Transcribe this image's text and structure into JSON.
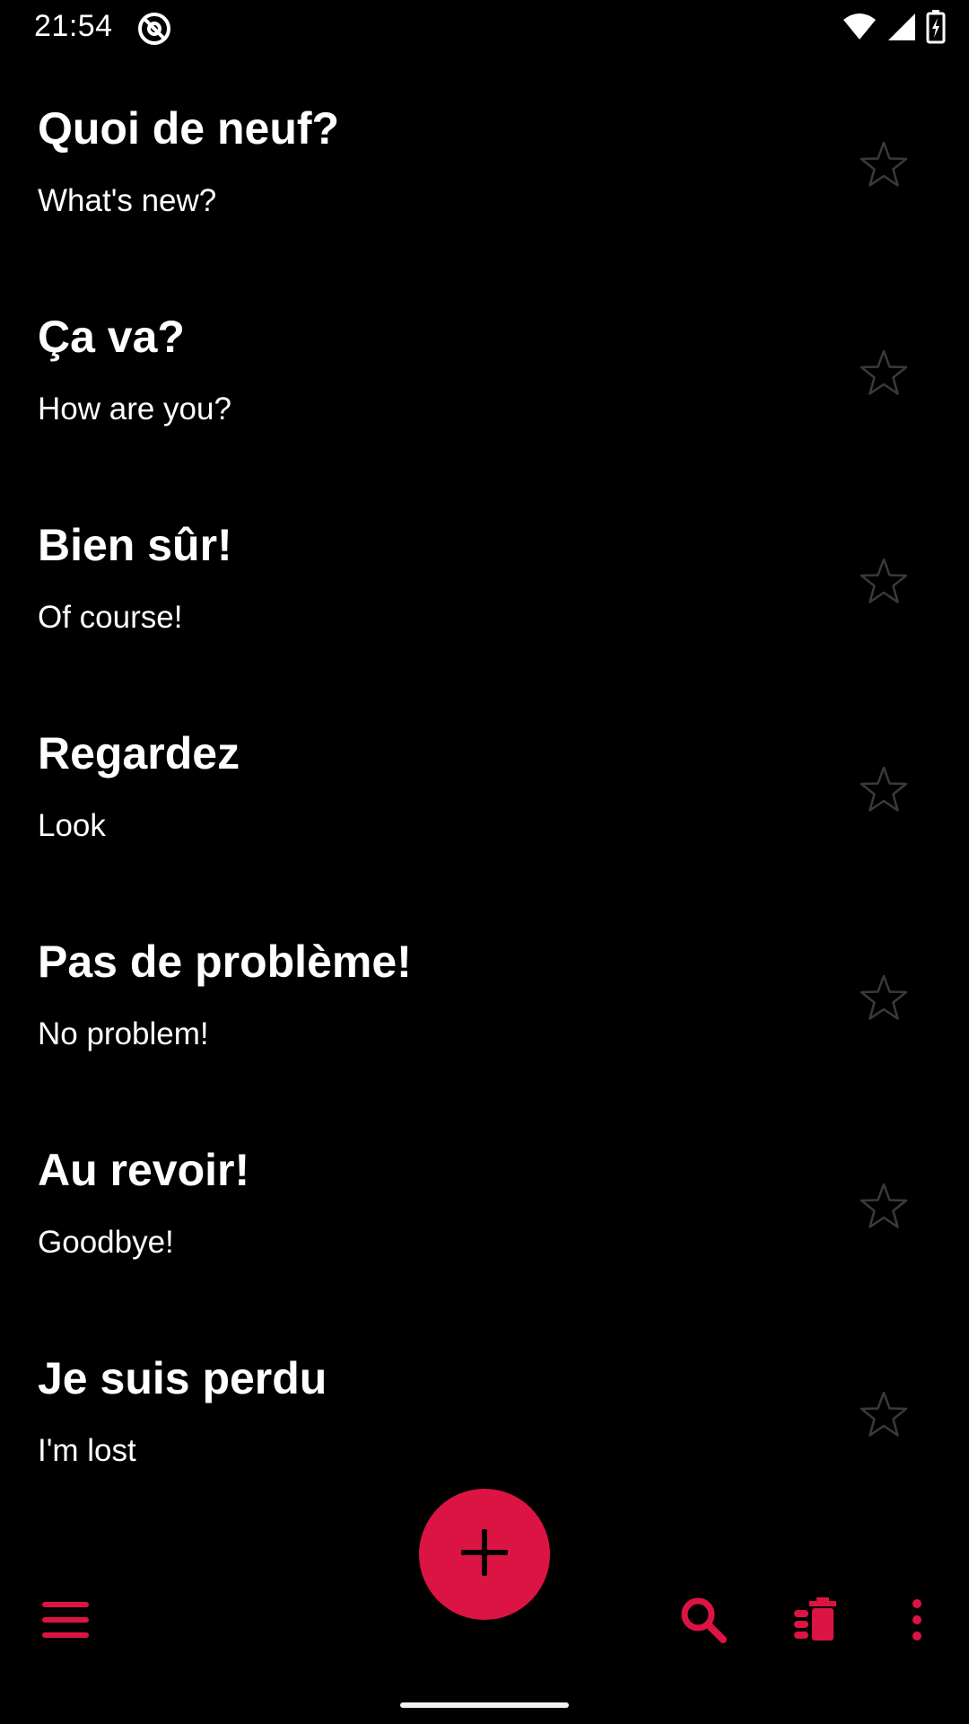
{
  "status_bar": {
    "time": "21:54",
    "icons": [
      "at-sign-icon",
      "wifi-icon",
      "signal-icon",
      "battery-charging-icon"
    ]
  },
  "phrases": [
    {
      "french": "Quoi de neuf?",
      "english": "What's new?",
      "starred": false
    },
    {
      "french": "Ça va?",
      "english": "How are you?",
      "starred": false
    },
    {
      "french": "Bien sûr!",
      "english": "Of course!",
      "starred": false
    },
    {
      "french": "Regardez",
      "english": "Look",
      "starred": false
    },
    {
      "french": "Pas de problème!",
      "english": "No problem!",
      "starred": false
    },
    {
      "french": "Au revoir!",
      "english": "Goodbye!",
      "starred": false
    },
    {
      "french": "Je suis perdu",
      "english": "I'm lost",
      "starred": false
    }
  ],
  "bottom_bar": {
    "icons": [
      "menu-icon",
      "search-icon",
      "delete-all-icon",
      "more-vert-icon"
    ]
  },
  "fab": {
    "icon": "plus-icon"
  },
  "colors": {
    "background": "#000000",
    "accent": "#dc1444",
    "text": "#ffffff",
    "star_outline": "#3a3a3a"
  }
}
